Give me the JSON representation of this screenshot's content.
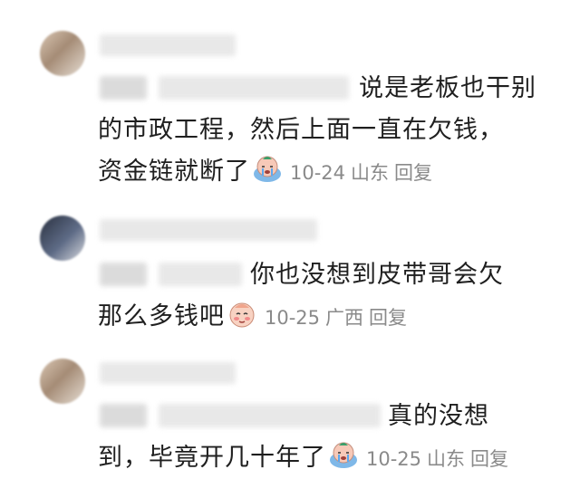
{
  "comments": [
    {
      "lines": [
        "说是老板也干别",
        "的市政工程，然后上面一直在欠钱，",
        "资金链就断了"
      ],
      "emoji": "crying-face-icon",
      "date": "10-24",
      "location": "山东",
      "reply_label": "回复"
    },
    {
      "lines": [
        "你也没想到皮带哥会欠",
        "那么多钱吧"
      ],
      "emoji": "blushing-face-icon",
      "date": "10-25",
      "location": "广西",
      "reply_label": "回复"
    },
    {
      "lines": [
        "真的没想",
        "到，毕竟开几十年了"
      ],
      "emoji": "crying-face-icon",
      "date": "10-25",
      "location": "山东",
      "reply_label": "回复"
    }
  ],
  "colors": {
    "text": "#1f1f1f",
    "meta": "#8a8a8a"
  }
}
